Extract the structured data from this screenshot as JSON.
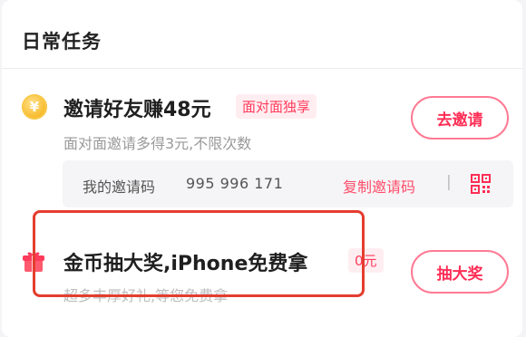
{
  "section": {
    "title": "日常任务"
  },
  "tasks": [
    {
      "coin_symbol": "¥",
      "title": "邀请好友赚48元",
      "tag": "面对面独享",
      "description": "面对面邀请多得3元,不限次数",
      "button": "去邀请",
      "invite": {
        "label": "我的邀请码",
        "code": "995 996 171",
        "copy_label": "复制邀请码",
        "separator": "|"
      }
    },
    {
      "title": "金币抽大奖,iPhone免费拿",
      "tag": "0元",
      "description": "超多丰厚好礼,等您免费拿",
      "button": "抽大奖"
    }
  ],
  "colors": {
    "accent": "#ff2d55",
    "highlight": "#e43d2f",
    "coin": "#f7b825"
  },
  "icons": {
    "coin": "coin-icon",
    "qr": "qr-code-icon",
    "gift": "gift-icon"
  }
}
